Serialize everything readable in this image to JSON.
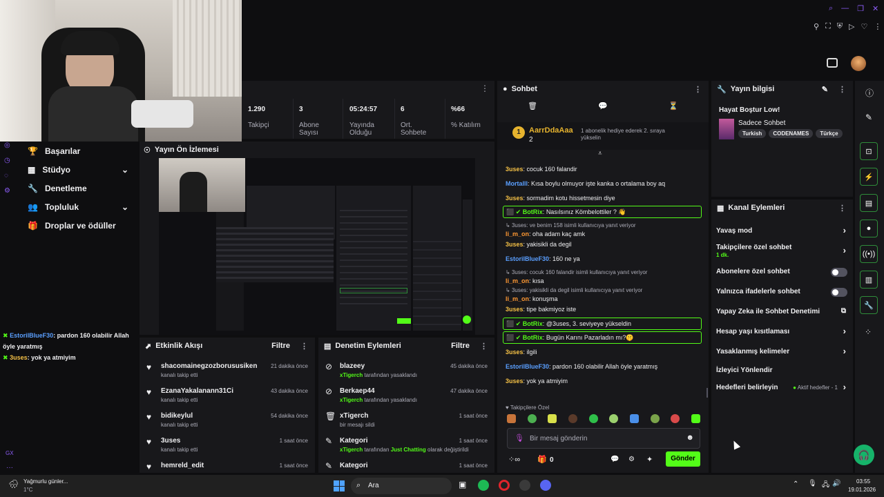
{
  "colors": {
    "accent": "#53fc18",
    "bg": "#0e0e10",
    "panel": "#18181b"
  },
  "stats": [
    {
      "value": "1.290",
      "label": "Takipçi"
    },
    {
      "value": "3",
      "label": "Abone Sayısı"
    },
    {
      "value": "05:24:57",
      "label": "Yayında Olduğu"
    },
    {
      "value": "6",
      "label": "Ort. Sohbete"
    },
    {
      "value": "%66",
      "label": "% Katılım"
    }
  ],
  "sidebar": {
    "items": [
      {
        "label": "Başarılar",
        "icon": "trophy-icon"
      },
      {
        "label": "Stüdyo",
        "icon": "studio-icon"
      },
      {
        "label": "Denetleme",
        "icon": "wrench-icon"
      },
      {
        "label": "Topluluk",
        "icon": "community-icon"
      },
      {
        "label": "Droplar ve ödüller",
        "icon": "gift-icon"
      }
    ]
  },
  "left_chat": [
    {
      "user": "EstorilBlueF30",
      "text": ": pardon 160 olabilir Allah öyle yaratmış"
    },
    {
      "user": "3uses",
      "text": ": yok ya atmiyim"
    }
  ],
  "preview": {
    "title": "Yayın Ön İzlemesi"
  },
  "activity": {
    "title": "Etkinlik Akışı",
    "filter": "Filtre",
    "items": [
      {
        "name": "shacomainegzozborususiken",
        "sub": "kanalı takip etti",
        "time": "21 dakika önce"
      },
      {
        "name": "EzanaYakalanann31Ci",
        "sub": "kanalı takip etti",
        "time": "43 dakika önce"
      },
      {
        "name": "bidikeylul",
        "sub": "kanalı takip etti",
        "time": "54 dakika önce"
      },
      {
        "name": "3uses",
        "sub": "kanalı takip etti",
        "time": "1 saat önce"
      },
      {
        "name": "hemreld_edit",
        "sub": "",
        "time": "1 saat önce"
      }
    ]
  },
  "moderation": {
    "title": "Denetim Eylemleri",
    "filter": "Filtre",
    "items": [
      {
        "name": "blazeey",
        "mod": "xTigerch",
        "sub": " tarafından yasaklandı",
        "extra": "",
        "extra2": "",
        "time": "45 dakika önce",
        "icon": "ban-icon"
      },
      {
        "name": "Berkaep44",
        "mod": "xTigerch",
        "sub": " tarafından yasaklandı",
        "extra": "",
        "extra2": "",
        "time": "47 dakika önce",
        "icon": "ban-icon"
      },
      {
        "name": "xTigerch",
        "mod": "",
        "sub": "bir mesajı sildi",
        "extra": "",
        "extra2": "",
        "time": "1 saat önce",
        "icon": "trash-icon"
      },
      {
        "name": "Kategori",
        "mod": "xTigerch",
        "sub": " tarafından ",
        "extra": "Just Chatting",
        "extra2": " olarak değiştirildi",
        "time": "1 saat önce",
        "icon": "edit-icon"
      },
      {
        "name": "Kategori",
        "mod": "",
        "sub": "",
        "extra": "",
        "extra2": "",
        "time": "1 saat önce",
        "icon": "edit-icon"
      }
    ]
  },
  "chat": {
    "title": "Sohbet",
    "pinned": {
      "user": "AarrDdaAaa",
      "count": "2",
      "text": "1 abonelik hediye ederek 2. sıraya yükselin"
    },
    "messages": [
      {
        "type": "msg",
        "user": "3uses",
        "color": "yellow",
        "text": "cocuk 160 falandir"
      },
      {
        "type": "msg",
        "user": "Mortalll",
        "color": "blue",
        "text": "Kısa boylu olmuyor işte kanka o ortalama boy aq"
      },
      {
        "type": "msg",
        "user": "3uses",
        "color": "yellow",
        "text": "sormadim kotu hissetmesin diye"
      },
      {
        "type": "bot",
        "user": "BotRix",
        "text": "Nasılsınız Kömbelottiler ? 👋"
      },
      {
        "type": "reply",
        "reply": "3uses: ve benim 158 isimli kullanıcıya yanıt veriyor",
        "user": "li_m_on",
        "color": "orange",
        "text": "oha adam kaç amk"
      },
      {
        "type": "msg",
        "user": "3uses",
        "color": "yellow",
        "text": "yakisikli da degil"
      },
      {
        "type": "msg",
        "user": "EstorilBlueF30",
        "color": "blue",
        "text": "160 ne ya"
      },
      {
        "type": "reply",
        "reply": "3uses: cocuk 160 falandir isimli kullanıcıya yanıt veriyor",
        "user": "li_m_on",
        "color": "orange",
        "text": "kısa"
      },
      {
        "type": "reply",
        "reply": "3uses: yakisikli da degil isimli kullanıcıya yanıt veriyor",
        "user": "li_m_on",
        "color": "orange",
        "text": "konuşma"
      },
      {
        "type": "msg",
        "user": "3uses",
        "color": "yellow",
        "text": "tipe bakmiyoz iste"
      },
      {
        "type": "bot",
        "user": "BotRix",
        "text": "@3uses, 3. seviyeye yükseldin"
      },
      {
        "type": "bot",
        "user": "BotRix",
        "text": "Bugün Karını Pazarladın mı?🤫"
      },
      {
        "type": "msg",
        "user": "3uses",
        "color": "yellow",
        "text": "ilgili"
      },
      {
        "type": "msg",
        "user": "EstorilBlueF30",
        "color": "blue",
        "text": "pardon 160 olabilir Allah öyle yaratmış"
      },
      {
        "type": "msg",
        "user": "3uses",
        "color": "yellow",
        "text": "yok ya atmiyim"
      }
    ],
    "emote_label": "Takipçilere Özel",
    "input_placeholder": "Bir mesaj gönderin",
    "points": "0",
    "send": "Gönder"
  },
  "stream_info": {
    "title": "Yayın bilgisi",
    "stream_title": "Hayat Boştur Low!",
    "category": "Sadece Sohbet",
    "tags": [
      "Turkish",
      "CODENAMES",
      "Türkçe"
    ]
  },
  "channel_actions": {
    "title": "Kanal Eylemleri",
    "items": [
      {
        "label": "Yavaş mod",
        "control": "chevron",
        "sub": "",
        "extra": ""
      },
      {
        "label": "Takipçilere özel sohbet",
        "control": "chevron",
        "sub": "1 dk.",
        "extra": ""
      },
      {
        "label": "Abonelere özel sohbet",
        "control": "toggle",
        "sub": "",
        "extra": ""
      },
      {
        "label": "Yalnızca ifadelerle sohbet",
        "control": "toggle",
        "sub": "",
        "extra": ""
      },
      {
        "label": "Yapay Zeka ile Sohbet Denetimi",
        "control": "external",
        "sub": "",
        "extra": ""
      },
      {
        "label": "Hesap yaşı kısıtlaması",
        "control": "chevron",
        "sub": "",
        "extra": ""
      },
      {
        "label": "Yasaklanmış kelimeler",
        "control": "chevron",
        "sub": "",
        "extra": ""
      },
      {
        "label": "İzleyici Yönlendir",
        "control": "none",
        "sub": "",
        "extra": ""
      },
      {
        "label": "Hedefleri belirleyin",
        "control": "chevron",
        "sub": "",
        "extra": "Aktif hedefler - 1"
      }
    ]
  },
  "taskbar": {
    "weather_title": "Yağmurlu günler...",
    "weather_temp": "1°C",
    "search": "Ara",
    "time": "03:55",
    "date": "19.01.2026"
  },
  "side_rail_label": "GX"
}
